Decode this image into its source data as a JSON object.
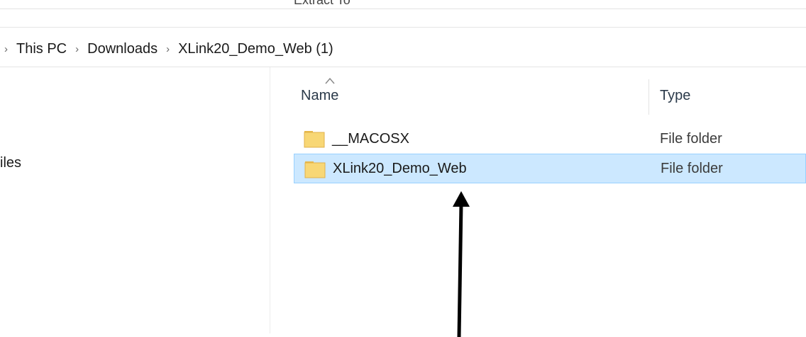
{
  "ribbon": {
    "label": "Extract To"
  },
  "address_bar": {
    "crumbs": [
      "This PC",
      "Downloads",
      "XLink20_Demo_Web (1)"
    ]
  },
  "nav_pane": {
    "visible_item": "iles"
  },
  "columns": {
    "name": "Name",
    "type": "Type",
    "sort": "ascending"
  },
  "rows": [
    {
      "name": "__MACOSX",
      "type": "File folder",
      "selected": false
    },
    {
      "name": "XLink20_Demo_Web",
      "type": "File folder",
      "selected": true
    }
  ],
  "colors": {
    "selection_bg": "#cce8ff",
    "selection_border": "#99d1ff",
    "folder_yellow": "#f8d775",
    "arrow": "#000000"
  },
  "icons": [
    "chevron-right-icon",
    "sort-up-caret-icon",
    "folder-icon",
    "arrow-up-icon"
  ]
}
